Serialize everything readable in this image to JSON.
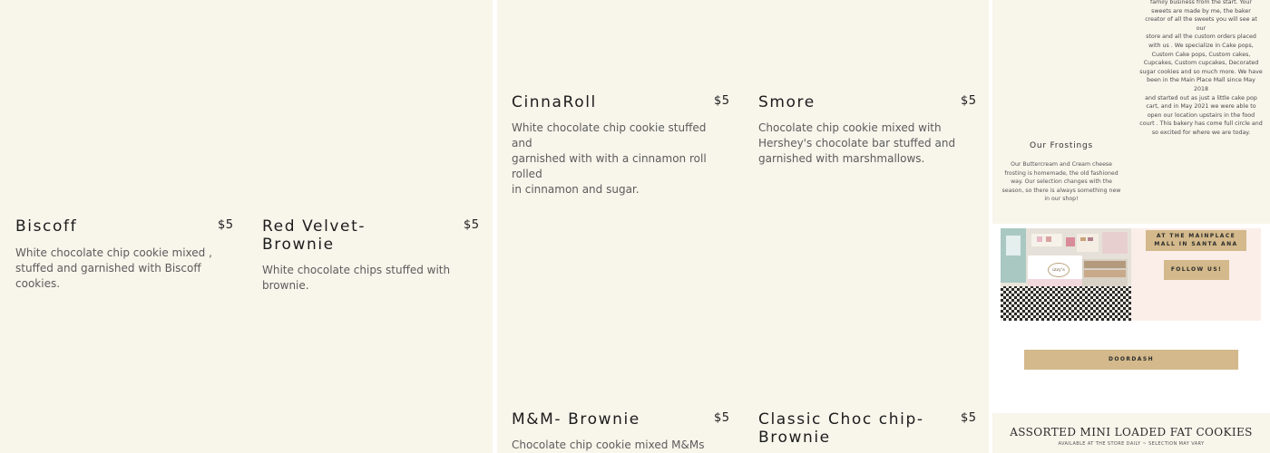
{
  "menu": {
    "items": [
      {
        "name": "Biscoff",
        "price": "$5",
        "description": " White chocolate chip cookie mixed ,\nstuffed and garnished with Biscoff cookies."
      },
      {
        "name": "Red Velvet-\nBrownie",
        "price": "$5",
        "description": "White chocolate chips stuffed with\nbrownie."
      },
      {
        "name": "CinnaRoll",
        "price": "$5",
        "description": "White chocolate chip cookie stuffed and\ngarnished with with a cinnamon roll rolled\nin cinnamon and sugar."
      },
      {
        "name": "Smore",
        "price": "$5",
        "description": "Chocolate chip cookie mixed with\nHershey's chocolate bar stuffed and\ngarnished with marshmallows."
      },
      {
        "name": "M&M- Brownie",
        "price": "$5",
        "description": "Chocolate chip cookie mixed M&Ms"
      },
      {
        "name": "Classic Choc chip-\nBrownie",
        "price": "$5",
        "description": ""
      }
    ]
  },
  "about": {
    "text": "family business from the start. Your\nsweets are made by me, the baker\ncreator of all the sweets you will see at our\nstore and all the custom orders placed\nwith us .  We specialize in Cake pops,\nCustom Cake pops, Custom cakes,\nCupcakes, Custom cupcakes, Decorated\nsugar cookies and so much more. We have\nbeen in the Main Place Mall since May 2018\nand started out as just a little cake pop\ncart, and in May 2021 we were able to\nopen  our location upstairs in the food\ncourt . This bakery has come full circle and\nso excited for where we are today."
  },
  "frostings": {
    "title": "Our Frostings",
    "text": "Our Buttercream and Cream cheese\nfrosting is homemade, the old fashioned\nway.  Our selection changes with the\nseason, so there is always something new\nin our shop!"
  },
  "promo": {
    "store_sign": "izzy's",
    "location_badge": "AT THE MAINPLACE\nMALL IN SANTA ANA",
    "follow_label": "FOLLOW US!",
    "doordash_label": "DOORDASH"
  },
  "cookies": {
    "title": "ASSORTED MINI LOADED FAT COOKIES",
    "subtitle": "AVAILABLE AT THE STORE DAILY ~ SELECTION MAY VARY"
  },
  "colors": {
    "panel_bg": "#f8f5eb",
    "accent_tan": "#d3b98b",
    "promo_pink": "#fbeee9"
  }
}
